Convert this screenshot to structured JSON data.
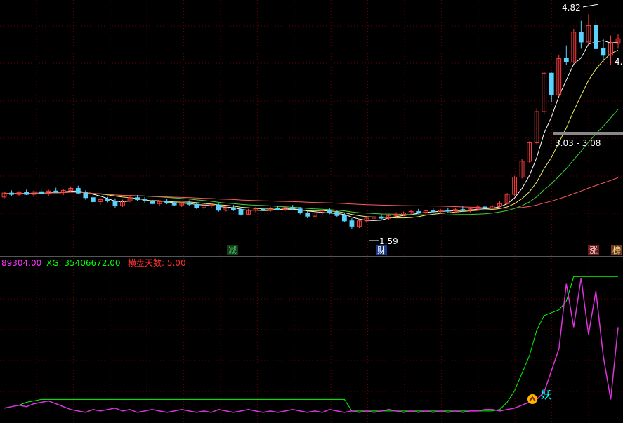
{
  "colors": {
    "background": "#000000",
    "grid": "#6e0000",
    "up": "#ff3c3c",
    "down": "#5ad2ff",
    "ma_white": "#ffffff",
    "ma_yellow": "#f0f064",
    "ma_green": "#3cd23c",
    "ma_pink": "#ff5a5a",
    "indicator_main": "#00ff00",
    "indicator_osc": "#dd33dd",
    "marker_face": "#ffb400",
    "marker_text": "#00ffff",
    "legend_value": "#ff33ff",
    "legend_xg": "#00ff00",
    "legend_days": "#ff3030"
  },
  "price_panel": {
    "annotations": {
      "high": "4.82",
      "low": "1.59",
      "range": "3.03 - 3.08",
      "right_value": "4."
    },
    "badges": [
      {
        "text": "减",
        "color": "#33cc66",
        "bg": "#1a3a1a"
      },
      {
        "text": "财",
        "color": "#ffffff",
        "bg": "#1a3a8a"
      },
      {
        "text": "涨",
        "color": "#ffcccc",
        "bg": "#6a1a1a"
      },
      {
        "text": "榜",
        "color": "#ffdd99",
        "bg": "#6a3a1a"
      }
    ]
  },
  "indicator_panel": {
    "legend": [
      {
        "text": "89304.00",
        "color": "#ff33ff"
      },
      {
        "text": "XG: 35406672.00",
        "color": "#00ff00"
      },
      {
        "text": "横盘天数: 5.00",
        "color": "#ff3030"
      }
    ],
    "marker_label": "妖",
    "marker_icon": "chevron-up-icon"
  },
  "chart_data": {
    "type": "candlestick",
    "title": "",
    "y_range": [
      1.2,
      4.95
    ],
    "bars": [
      [
        2.06,
        2.14,
        2.04,
        2.12
      ],
      [
        2.12,
        2.16,
        2.08,
        2.1
      ],
      [
        2.1,
        2.15,
        2.07,
        2.13
      ],
      [
        2.13,
        2.17,
        2.09,
        2.1
      ],
      [
        2.1,
        2.16,
        2.06,
        2.14
      ],
      [
        2.14,
        2.18,
        2.1,
        2.11
      ],
      [
        2.11,
        2.17,
        2.08,
        2.15
      ],
      [
        2.15,
        2.2,
        2.12,
        2.13
      ],
      [
        2.13,
        2.18,
        2.09,
        2.16
      ],
      [
        2.16,
        2.22,
        2.13,
        2.19
      ],
      [
        2.19,
        2.23,
        2.1,
        2.12
      ],
      [
        2.12,
        2.16,
        2.02,
        2.05
      ],
      [
        2.05,
        2.08,
        1.96,
        1.99
      ],
      [
        1.99,
        2.04,
        1.94,
        2.02
      ],
      [
        2.02,
        2.06,
        1.98,
        2.0
      ],
      [
        2.0,
        2.04,
        1.9,
        1.93
      ],
      [
        1.93,
        2.02,
        1.91,
        2.0
      ],
      [
        2.0,
        2.08,
        1.98,
        2.05
      ],
      [
        2.05,
        2.09,
        2.0,
        2.02
      ],
      [
        2.02,
        2.06,
        1.97,
        2.0
      ],
      [
        2.0,
        2.03,
        1.94,
        1.96
      ],
      [
        1.96,
        2.01,
        1.93,
        1.99
      ],
      [
        1.99,
        2.03,
        1.95,
        1.97
      ],
      [
        1.97,
        2.0,
        1.92,
        1.94
      ],
      [
        1.94,
        1.99,
        1.91,
        1.97
      ],
      [
        1.97,
        2.01,
        1.93,
        1.95
      ],
      [
        1.95,
        1.98,
        1.88,
        1.9
      ],
      [
        1.9,
        1.95,
        1.87,
        1.93
      ],
      [
        1.93,
        1.97,
        1.9,
        1.94
      ],
      [
        1.94,
        1.96,
        1.84,
        1.86
      ],
      [
        1.86,
        1.92,
        1.84,
        1.9
      ],
      [
        1.9,
        1.94,
        1.85,
        1.87
      ],
      [
        1.87,
        1.91,
        1.78,
        1.8
      ],
      [
        1.8,
        1.88,
        1.79,
        1.86
      ],
      [
        1.86,
        1.91,
        1.83,
        1.88
      ],
      [
        1.88,
        1.92,
        1.85,
        1.86
      ],
      [
        1.86,
        1.91,
        1.84,
        1.89
      ],
      [
        1.89,
        1.93,
        1.86,
        1.87
      ],
      [
        1.87,
        1.92,
        1.85,
        1.9
      ],
      [
        1.9,
        1.94,
        1.86,
        1.88
      ],
      [
        1.88,
        1.91,
        1.8,
        1.82
      ],
      [
        1.82,
        1.85,
        1.74,
        1.77
      ],
      [
        1.77,
        1.84,
        1.75,
        1.82
      ],
      [
        1.82,
        1.87,
        1.79,
        1.85
      ],
      [
        1.85,
        1.89,
        1.8,
        1.83
      ],
      [
        1.83,
        1.86,
        1.76,
        1.78
      ],
      [
        1.78,
        1.82,
        1.68,
        1.7
      ],
      [
        1.7,
        1.74,
        1.58,
        1.62
      ],
      [
        1.62,
        1.72,
        1.59,
        1.7
      ],
      [
        1.7,
        1.76,
        1.67,
        1.74
      ],
      [
        1.74,
        1.79,
        1.7,
        1.76
      ],
      [
        1.76,
        1.8,
        1.72,
        1.74
      ],
      [
        1.74,
        1.8,
        1.72,
        1.78
      ],
      [
        1.78,
        1.83,
        1.75,
        1.8
      ],
      [
        1.8,
        1.84,
        1.77,
        1.82
      ],
      [
        1.82,
        1.86,
        1.79,
        1.84
      ],
      [
        1.84,
        1.88,
        1.81,
        1.83
      ],
      [
        1.83,
        1.87,
        1.8,
        1.85
      ],
      [
        1.85,
        1.89,
        1.82,
        1.84
      ],
      [
        1.84,
        1.88,
        1.81,
        1.86
      ],
      [
        1.86,
        1.9,
        1.82,
        1.85
      ],
      [
        1.85,
        1.89,
        1.83,
        1.87
      ],
      [
        1.87,
        1.92,
        1.84,
        1.86
      ],
      [
        1.86,
        1.9,
        1.83,
        1.88
      ],
      [
        1.88,
        1.94,
        1.85,
        1.91
      ],
      [
        1.91,
        1.96,
        1.87,
        1.89
      ],
      [
        1.89,
        1.94,
        1.86,
        1.92
      ],
      [
        1.92,
        2.0,
        1.9,
        1.96
      ],
      [
        1.96,
        2.12,
        1.95,
        2.1
      ],
      [
        2.1,
        2.38,
        2.08,
        2.36
      ],
      [
        2.36,
        2.64,
        2.34,
        2.6
      ],
      [
        2.6,
        2.9,
        2.58,
        2.88
      ],
      [
        2.88,
        3.4,
        2.86,
        3.35
      ],
      [
        3.35,
        3.95,
        3.3,
        3.93
      ],
      [
        3.93,
        3.94,
        3.5,
        3.6
      ],
      [
        3.6,
        4.2,
        3.58,
        4.15
      ],
      [
        4.15,
        4.35,
        4.05,
        4.1
      ],
      [
        4.1,
        4.6,
        4.08,
        4.55
      ],
      [
        4.55,
        4.72,
        4.3,
        4.4
      ],
      [
        4.4,
        4.82,
        4.35,
        4.65
      ],
      [
        4.65,
        4.75,
        4.25,
        4.3
      ],
      [
        4.3,
        4.45,
        4.1,
        4.2
      ],
      [
        4.2,
        4.5,
        4.05,
        4.38
      ],
      [
        4.38,
        4.52,
        4.3,
        4.45
      ]
    ],
    "indicator": {
      "y_range": [
        0,
        100
      ],
      "xg_line": [
        4,
        5,
        6,
        8,
        9,
        10,
        10,
        10,
        10,
        10,
        10,
        10,
        10,
        10,
        10,
        10,
        10,
        10,
        10,
        10,
        10,
        10,
        10,
        10,
        10,
        10,
        10,
        10,
        10,
        10,
        10,
        10,
        10,
        10,
        10,
        10,
        10,
        10,
        10,
        10,
        10,
        10,
        10,
        10,
        10,
        10,
        10,
        2,
        2,
        2,
        2,
        2,
        2,
        2,
        2,
        2,
        2,
        2,
        2,
        2,
        2,
        2,
        2,
        2,
        2,
        2,
        2,
        3,
        8,
        16,
        28,
        40,
        58,
        68,
        70,
        72,
        78,
        95,
        95,
        95,
        95,
        95,
        95,
        95
      ],
      "osc_line": [
        4,
        5,
        6,
        5,
        7,
        8,
        9,
        7,
        5,
        3,
        2,
        1,
        3,
        2,
        3,
        4,
        2,
        3,
        1,
        2,
        3,
        2,
        1,
        2,
        3,
        2,
        1,
        2,
        1,
        3,
        2,
        1,
        2,
        3,
        2,
        1,
        2,
        1,
        2,
        3,
        2,
        1,
        2,
        1,
        3,
        2,
        1,
        2,
        1,
        2,
        1,
        2,
        3,
        2,
        1,
        2,
        1,
        2,
        1,
        2,
        1,
        2,
        1,
        2,
        2,
        3,
        3,
        2,
        3,
        4,
        6,
        8,
        10,
        15,
        30,
        45,
        90,
        60,
        94,
        55,
        85,
        40,
        10,
        60
      ]
    }
  }
}
